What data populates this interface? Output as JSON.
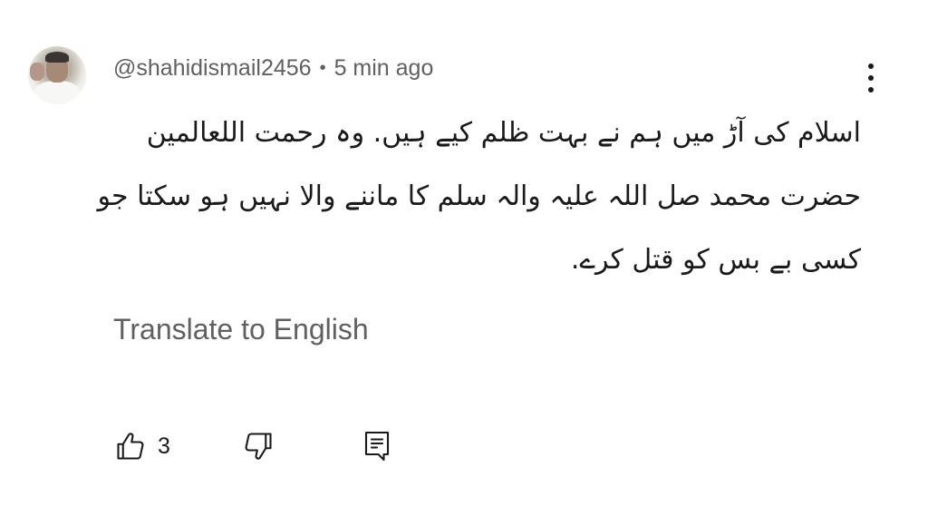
{
  "comment": {
    "author": "@shahidismail2456",
    "separator": "•",
    "time": "5 min ago",
    "text_lines": [
      "اسلام کی آڑ میں ہم نے بہت ظلم کیے ہیں. وہ رحمت اللعالمین",
      "حضرت محمد صل اللہ علیہ والہ سلم کا ماننے والا نہیں ہو سکتا جو",
      "کسی بے بس کو قتل کرے."
    ],
    "translate_label": "Translate to English",
    "like_count": "3"
  },
  "icons": {
    "avatar": "user-avatar",
    "more": "more-vertical-icon",
    "like": "thumbs-up-icon",
    "dislike": "thumbs-down-icon",
    "reply": "comment-reply-icon"
  },
  "colors": {
    "text_primary": "#1a1a1a",
    "text_secondary": "#606060",
    "background": "#ffffff"
  }
}
